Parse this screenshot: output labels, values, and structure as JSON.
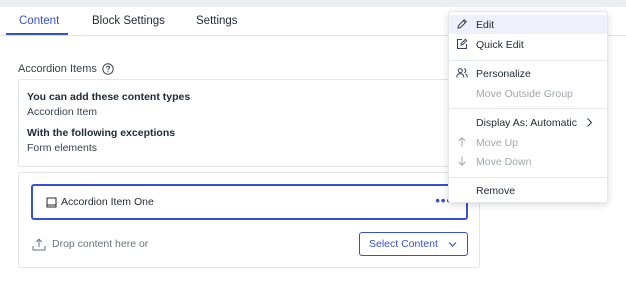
{
  "tabs": [
    {
      "label": "Content",
      "active": true
    },
    {
      "label": "Block Settings",
      "active": false
    },
    {
      "label": "Settings",
      "active": false
    }
  ],
  "section": {
    "label": "Accordion Items",
    "help_icon": "question-circle-icon"
  },
  "content_types": {
    "heading": "You can add these content types",
    "allowed": "Accordion Item",
    "exceptions_heading": "With the following exceptions",
    "exceptions": "Form elements"
  },
  "item": {
    "icon": "block-icon",
    "label": "Accordion Item One",
    "more_label": "•••"
  },
  "drop": {
    "icon": "upload-tray-icon",
    "label": "Drop content here or"
  },
  "select_button": {
    "label": "Select Content",
    "icon": "chevron-down-icon"
  },
  "context_menu": {
    "items": [
      {
        "label": "Edit",
        "icon": "pencil-icon",
        "disabled": false,
        "hover": true
      },
      {
        "label": "Quick Edit",
        "icon": "edit-box-icon",
        "disabled": false
      },
      {
        "label": "Personalize",
        "icon": "people-icon",
        "disabled": false
      },
      {
        "label": "Move Outside Group",
        "icon": "",
        "disabled": true
      },
      {
        "label": "Display As: Automatic",
        "icon": "",
        "disabled": false,
        "submenu": true
      },
      {
        "label": "Move Up",
        "icon": "arrow-up-icon",
        "disabled": true
      },
      {
        "label": "Move Down",
        "icon": "arrow-down-icon",
        "disabled": true
      },
      {
        "label": "Remove",
        "icon": "",
        "disabled": false
      }
    ]
  },
  "colors": {
    "accent": "#3550d6",
    "border": "#e3e5ea",
    "disabled_text": "#a1a6b0",
    "hover_bg": "#eef1fb"
  }
}
